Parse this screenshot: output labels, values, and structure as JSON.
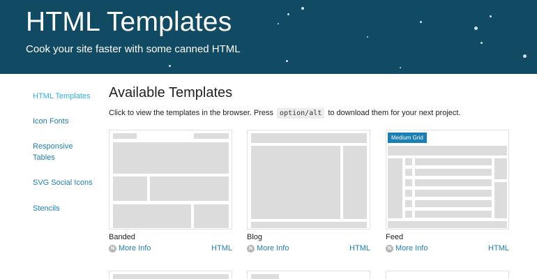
{
  "hero": {
    "title": "HTML Templates",
    "subtitle": "Cook your site faster with some canned HTML",
    "background": "#114a63"
  },
  "sidebar": {
    "items": [
      {
        "label": "HTML Templates",
        "active": true
      },
      {
        "label": "Icon Fonts"
      },
      {
        "label": "Responsive Tables"
      },
      {
        "label": "SVG Social Icons"
      },
      {
        "label": "Stencils"
      }
    ]
  },
  "main": {
    "title": "Available Templates",
    "intro_before": "Click to view the templates in the browser. Press",
    "intro_key": "option/alt",
    "intro_after": "to download them for your next project."
  },
  "cards": [
    {
      "name": "Banded",
      "more_info": "More Info",
      "html": "HTML",
      "info_icon": "N"
    },
    {
      "name": "Blog",
      "more_info": "More Info",
      "html": "HTML",
      "info_icon": "N"
    },
    {
      "name": "Feed",
      "more_info": "More Info",
      "html": "HTML",
      "info_icon": "N",
      "badge": "Medium Grid"
    }
  ],
  "colors": {
    "link": "#1b7fb4",
    "active_link": "#2bb1e8",
    "placeholder_block": "#dcdcdc"
  }
}
